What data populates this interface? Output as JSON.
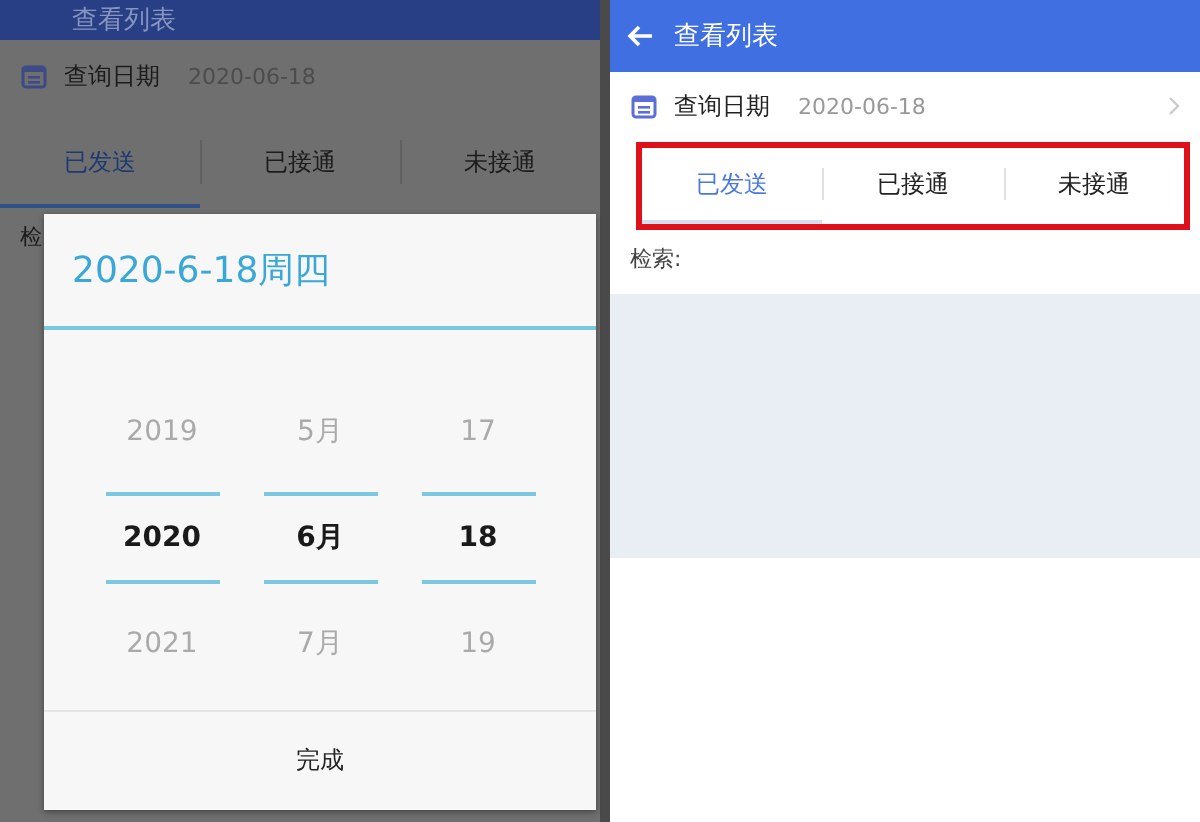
{
  "left_screen": {
    "title": "查看列表",
    "date_label": "查询日期",
    "date_value": "2020-06-18",
    "tabs": [
      {
        "label": "已发送",
        "selected": true
      },
      {
        "label": "已接通",
        "selected": false
      },
      {
        "label": "未接通",
        "selected": false
      }
    ],
    "search_label": "检",
    "dialog": {
      "heading": "2020-6-18周四",
      "columns": [
        {
          "items": [
            {
              "text": "2019",
              "selected": false
            },
            {
              "text": "2020",
              "selected": true
            },
            {
              "text": "2021",
              "selected": false
            }
          ]
        },
        {
          "items": [
            {
              "text": "5月",
              "selected": false
            },
            {
              "text": "6月",
              "selected": true
            },
            {
              "text": "7月",
              "selected": false
            }
          ]
        },
        {
          "items": [
            {
              "text": "17",
              "selected": false
            },
            {
              "text": "18",
              "selected": true
            },
            {
              "text": "19",
              "selected": false
            }
          ]
        }
      ],
      "done_button": "完成"
    }
  },
  "right_screen": {
    "title": "查看列表",
    "date_label": "查询日期",
    "date_value": "2020-06-18",
    "tabs": [
      {
        "label": "已发送",
        "selected": true
      },
      {
        "label": "已接通",
        "selected": false
      },
      {
        "label": "未接通",
        "selected": false
      }
    ],
    "search_label": "检索:"
  }
}
